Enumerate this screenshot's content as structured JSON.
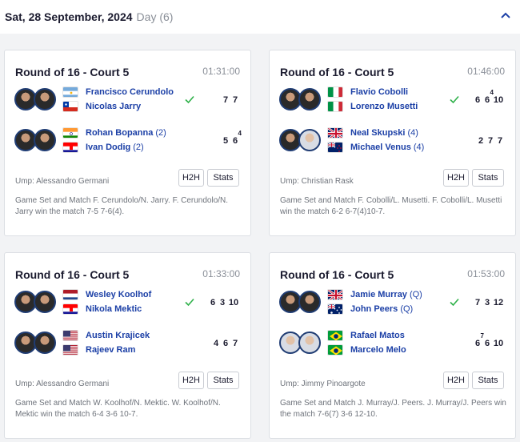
{
  "header": {
    "date": "Sat, 28 September, 2024",
    "day": "Day (6)"
  },
  "matches": [
    {
      "title": "Round of 16 - Court 5",
      "time": "01:31:00",
      "team1": {
        "p1": "Francisco Cerundolo",
        "p1_seed": "",
        "p2": "Nicolas Jarry",
        "p2_seed": "",
        "flags": [
          "argentina",
          "chile"
        ],
        "sets": [
          "7",
          "7"
        ],
        "tb": [
          "",
          ""
        ]
      },
      "team2": {
        "p1": "Rohan Bopanna",
        "p1_seed": "(2)",
        "p2": "Ivan Dodig",
        "p2_seed": "(2)",
        "flags": [
          "india",
          "croatia"
        ],
        "sets": [
          "5",
          "6"
        ],
        "tb": [
          "",
          "4"
        ]
      },
      "umpire": "Ump: Alessandro Germani",
      "summary": "Game Set and Match F. Cerundolo/N. Jarry. F. Cerundolo/N. Jarry win the match 7-5 7-6(4).",
      "h2h_label": "H2H",
      "stats_label": "Stats"
    },
    {
      "title": "Round of 16 - Court 5",
      "time": "01:46:00",
      "team1": {
        "p1": "Flavio Cobolli",
        "p1_seed": "",
        "p2": "Lorenzo Musetti",
        "p2_seed": "",
        "flags": [
          "italy",
          "italy"
        ],
        "sets": [
          "6",
          "6",
          "10"
        ],
        "tb": [
          "",
          "4",
          ""
        ]
      },
      "team2": {
        "p1": "Neal Skupski",
        "p1_seed": "(4)",
        "p2": "Michael Venus",
        "p2_seed": "(4)",
        "flags": [
          "gb",
          "nz"
        ],
        "sets": [
          "2",
          "7",
          "7"
        ],
        "tb": [
          "",
          "",
          ""
        ]
      },
      "umpire": "Ump: Christian Rask",
      "summary": "Game Set and Match F. Cobolli/L. Musetti. F. Cobolli/L. Musetti win the match 6-2 6-7(4)10-7.",
      "h2h_label": "H2H",
      "stats_label": "Stats"
    },
    {
      "title": "Round of 16 - Court 5",
      "time": "01:33:00",
      "team1": {
        "p1": "Wesley Koolhof",
        "p1_seed": "",
        "p2": "Nikola Mektic",
        "p2_seed": "",
        "flags": [
          "netherlands",
          "croatia"
        ],
        "sets": [
          "6",
          "3",
          "10"
        ],
        "tb": [
          "",
          "",
          ""
        ]
      },
      "team2": {
        "p1": "Austin Krajicek",
        "p1_seed": "",
        "p2": "Rajeev Ram",
        "p2_seed": "",
        "flags": [
          "usa",
          "usa"
        ],
        "sets": [
          "4",
          "6",
          "7"
        ],
        "tb": [
          "",
          "",
          ""
        ]
      },
      "umpire": "Ump: Alessandro Germani",
      "summary": "Game Set and Match W. Koolhof/N. Mektic. W. Koolhof/N. Mektic win the match 6-4 3-6 10-7.",
      "h2h_label": "H2H",
      "stats_label": "Stats"
    },
    {
      "title": "Round of 16 - Court 5",
      "time": "01:53:00",
      "team1": {
        "p1": "Jamie Murray",
        "p1_seed": "(Q)",
        "p2": "John Peers",
        "p2_seed": "(Q)",
        "flags": [
          "gb",
          "australia"
        ],
        "sets": [
          "7",
          "3",
          "12"
        ],
        "tb": [
          "",
          "",
          ""
        ]
      },
      "team2": {
        "p1": "Rafael Matos",
        "p1_seed": "",
        "p2": "Marcelo Melo",
        "p2_seed": "",
        "flags": [
          "brazil",
          "brazil"
        ],
        "sets": [
          "6",
          "6",
          "10"
        ],
        "tb": [
          "7",
          "",
          ""
        ]
      },
      "umpire": "Ump: Jimmy Pinoargote",
      "summary": "Game Set and Match J. Murray/J. Peers. J. Murray/J. Peers win the match 7-6(7) 3-6 12-10.",
      "h2h_label": "H2H",
      "stats_label": "Stats"
    }
  ],
  "colors": {
    "accent": "#1b3fa6",
    "win_check": "#2fb14a"
  }
}
